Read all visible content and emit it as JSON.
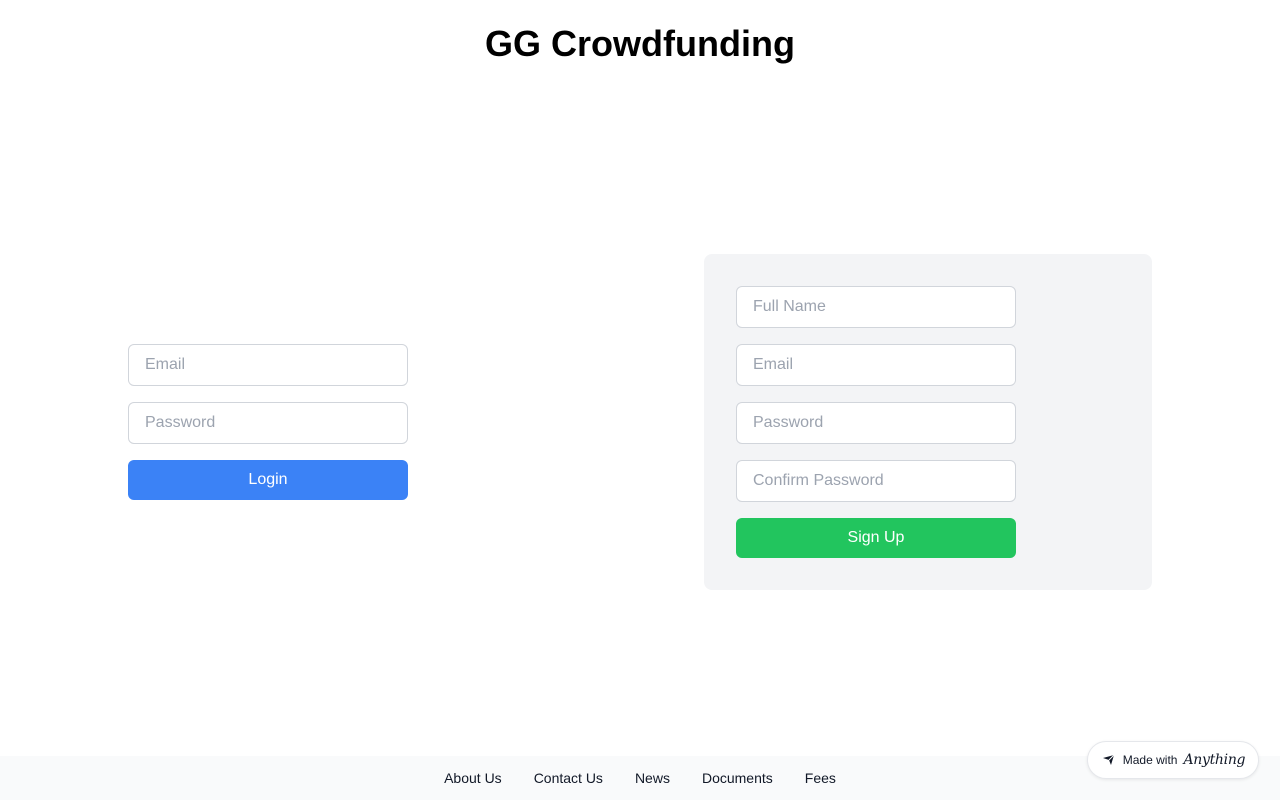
{
  "header": {
    "title": "GG Crowdfunding"
  },
  "login": {
    "email_placeholder": "Email",
    "password_placeholder": "Password",
    "submit_label": "Login"
  },
  "signup": {
    "fullname_placeholder": "Full Name",
    "email_placeholder": "Email",
    "password_placeholder": "Password",
    "confirm_placeholder": "Confirm Password",
    "submit_label": "Sign Up"
  },
  "footer": {
    "links": [
      "About Us",
      "Contact Us",
      "News",
      "Documents",
      "Fees"
    ]
  },
  "badge": {
    "prefix": "Made with",
    "brand": "Anything",
    "icon": "anything-logo-icon"
  },
  "colors": {
    "login_button": "#3b82f6",
    "signup_button": "#22c55e",
    "signup_card": "#f3f4f6",
    "footer_bg": "#f9fafb"
  }
}
